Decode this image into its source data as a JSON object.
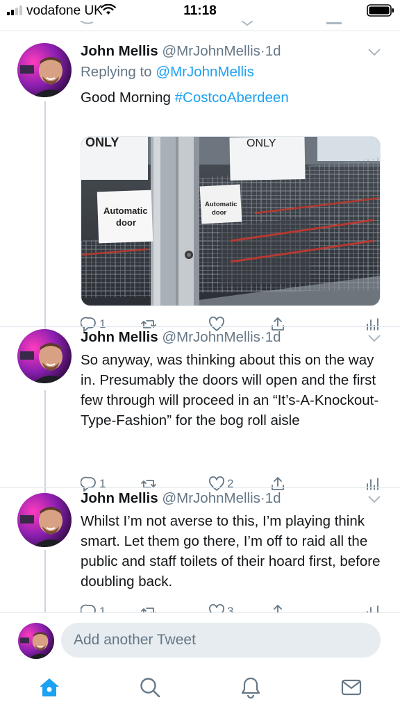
{
  "status_bar": {
    "carrier": "vodafone UK",
    "time": "11:18"
  },
  "colors": {
    "accent": "#1da1f2",
    "secondary_text": "#657786",
    "divider": "#e1e8ed"
  },
  "tweets": [
    {
      "name": "John Mellis",
      "handle": "@MrJohnMellis",
      "separator": "·",
      "time": "1d",
      "reply_prefix": "Replying to ",
      "reply_handle": "@MrJohnMellis",
      "text": "Good Morning ",
      "hashtag": "#CostcoAberdeen",
      "media": {
        "sign_left": "Automatic\ndoor",
        "sign_right": "Automatic\ndoor",
        "sign_top": "ONLY"
      },
      "replies": "1",
      "retweets": "",
      "likes": ""
    },
    {
      "name": "John Mellis",
      "handle": "@MrJohnMellis",
      "separator": "·",
      "time": "1d",
      "text": "So anyway, was thinking about this on the way in. Presumably the doors will open and the first few through will proceed in an “It’s-A-Knockout-Type-Fashion” for the bog roll aisle",
      "replies": "1",
      "retweets": "",
      "likes": "2"
    },
    {
      "name": "John Mellis",
      "handle": "@MrJohnMellis",
      "separator": "·",
      "time": "1d",
      "text": "Whilst I’m not averse to this, I’m playing think smart. Let them go there, I’m off to raid all the public and staff toilets of their hoard first, before doubling back.",
      "replies": "1",
      "retweets": "",
      "likes": "3"
    }
  ],
  "compose": {
    "placeholder": "Add another Tweet"
  },
  "tab_bar": {
    "icons": [
      "home-icon",
      "search-icon",
      "notifications-icon",
      "messages-icon"
    ],
    "active": "home-icon"
  }
}
